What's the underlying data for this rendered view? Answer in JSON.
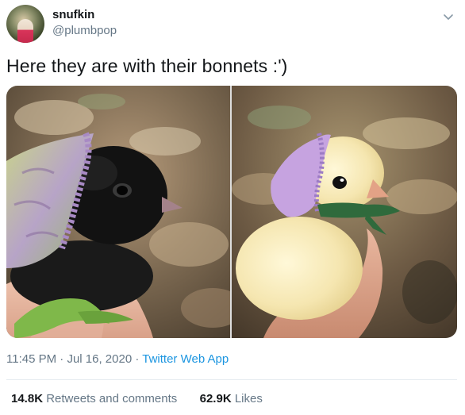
{
  "user": {
    "name": "snufkin",
    "handle": "@plumbpop"
  },
  "tweet": {
    "text": "Here they are with their bonnets :')",
    "time": "11:45 PM",
    "separator": "·",
    "date": "Jul 16, 2020",
    "source": "Twitter Web App"
  },
  "stats": {
    "retweets_count": "14.8K",
    "retweets_label": "Retweets and comments",
    "likes_count": "62.9K",
    "likes_label": "Likes"
  },
  "icons": {
    "menu": "chevron-down-icon"
  },
  "colors": {
    "secondary_text": "#657786",
    "link": "#1b95e0",
    "primary_text": "#14171a"
  }
}
